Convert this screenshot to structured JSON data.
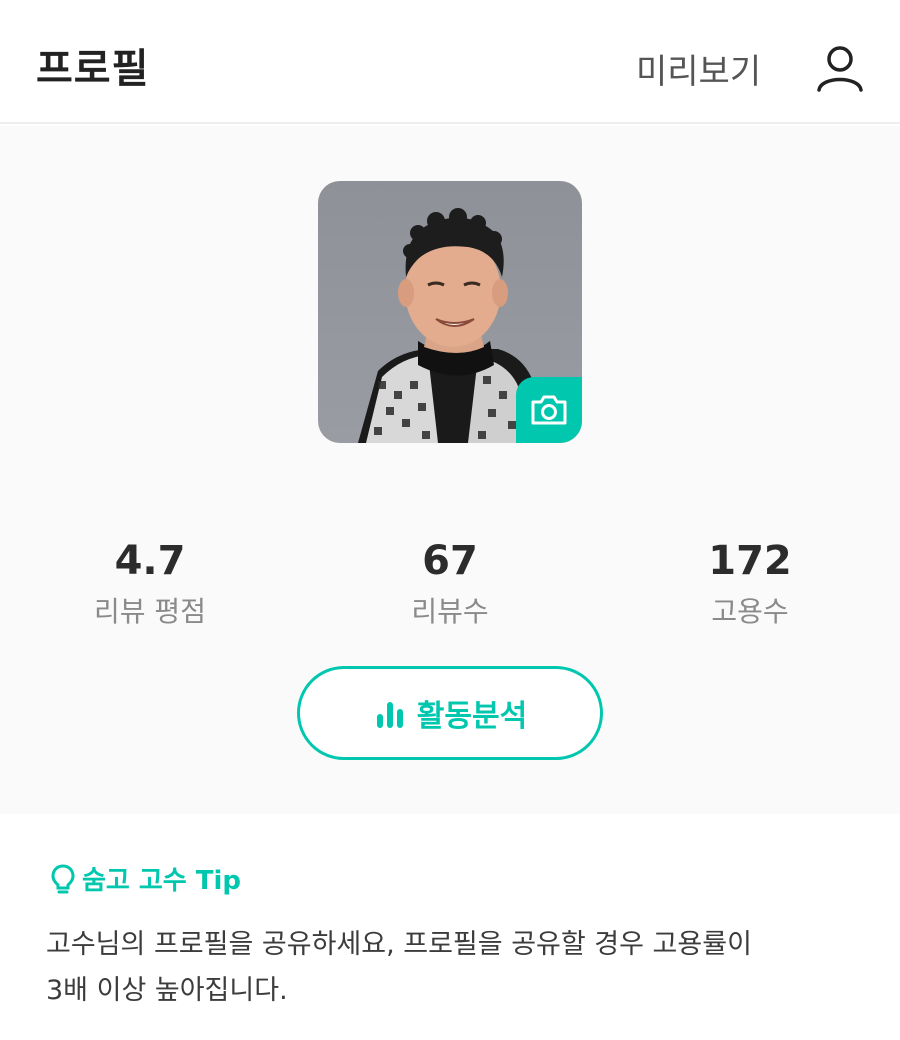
{
  "header": {
    "title": "프로필",
    "preview_label": "미리보기",
    "user_icon": "user-icon"
  },
  "profile": {
    "avatar_icon": "camera-icon",
    "stats": [
      {
        "value": "4.7",
        "label": "리뷰 평점"
      },
      {
        "value": "67",
        "label": "리뷰수"
      },
      {
        "value": "172",
        "label": "고용수"
      }
    ],
    "analytics_button": {
      "label": "활동분석",
      "icon": "bar-chart-icon"
    }
  },
  "tip": {
    "heading": "숨고 고수 Tip",
    "icon": "lightbulb-icon",
    "line1": "고수님의 프로필을 공유하세요, 프로필을 공유할 경우 고용률이",
    "line2": "3배 이상 높아집니다."
  },
  "colors": {
    "accent": "#00c7ae",
    "background": "#fafafa",
    "text_dark": "#222222",
    "text_muted": "#8a8a8a"
  }
}
